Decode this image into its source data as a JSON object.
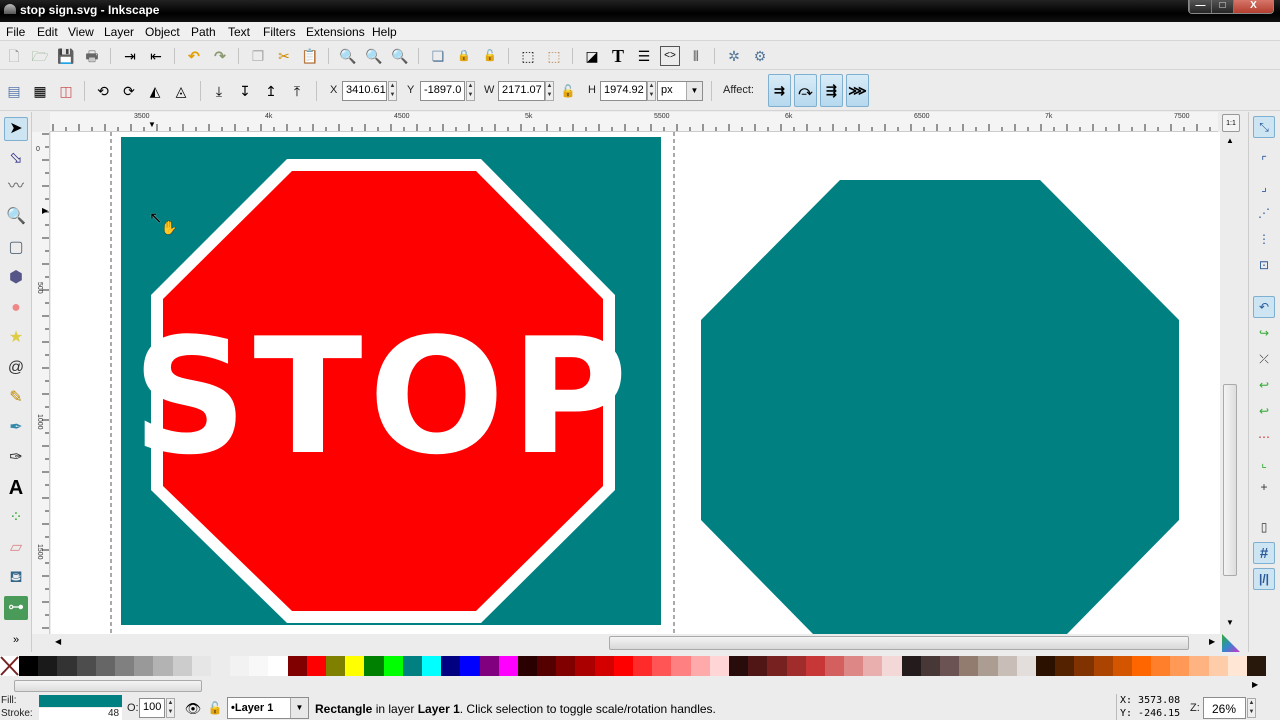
{
  "window": {
    "title": "stop sign.svg - Inkscape",
    "controls": {
      "minimize": "—",
      "maximize": "□",
      "close": "X"
    }
  },
  "menu": [
    "File",
    "Edit",
    "View",
    "Layer",
    "Object",
    "Path",
    "Text",
    "Filters",
    "Extensions",
    "Help"
  ],
  "commands_bar": [
    {
      "name": "new-document-icon",
      "glyph": "🗋"
    },
    {
      "name": "open-file-icon",
      "glyph": "🗁"
    },
    {
      "name": "save-icon",
      "glyph": "💾"
    },
    {
      "name": "print-icon",
      "glyph": "🖶"
    },
    {
      "name": "import-icon",
      "glyph": "⇥"
    },
    {
      "name": "export-icon",
      "glyph": "⇤"
    },
    {
      "name": "undo-icon",
      "glyph": "↶"
    },
    {
      "name": "redo-icon",
      "glyph": "↷"
    },
    {
      "name": "duplicate-icon",
      "glyph": "❐"
    },
    {
      "name": "cut-icon",
      "glyph": "✂"
    },
    {
      "name": "paste-icon",
      "glyph": "📋"
    },
    {
      "name": "zoom-selection-icon",
      "glyph": "🔍"
    },
    {
      "name": "zoom-drawing-icon",
      "glyph": "🔍"
    },
    {
      "name": "zoom-page-icon",
      "glyph": "🔍"
    },
    {
      "name": "duplicate-object-icon",
      "glyph": "❏"
    },
    {
      "name": "clone-icon",
      "glyph": "🔒"
    },
    {
      "name": "unlink-clone-icon",
      "glyph": "🔓"
    },
    {
      "name": "group-icon",
      "glyph": "⬚"
    },
    {
      "name": "ungroup-icon",
      "glyph": "⬚"
    },
    {
      "name": "fill-stroke-icon",
      "glyph": "◪"
    },
    {
      "name": "text-font-icon",
      "glyph": "T"
    },
    {
      "name": "layers-icon",
      "glyph": "☰"
    },
    {
      "name": "xml-editor-icon",
      "glyph": "<>"
    },
    {
      "name": "align-distribute-icon",
      "glyph": "⫴"
    },
    {
      "name": "preferences-icon",
      "glyph": "✲"
    },
    {
      "name": "document-properties-icon",
      "glyph": "⚙"
    }
  ],
  "tool_controls": {
    "select_all_icon": "▤",
    "select_all_layers_icon": "▦",
    "deselect_icon": "◫",
    "rotate_ccw_icon": "⟲",
    "rotate_cw_icon": "⟳",
    "flip_h_icon": "◭",
    "flip_v_icon": "◬",
    "lower_bottom_icon": "⤓",
    "lower_icon": "↧",
    "raise_icon": "↥",
    "raise_top_icon": "⤒",
    "x_label": "X",
    "x_value": "3410.61",
    "y_label": "Y",
    "y_value": "-1897.0",
    "w_label": "W",
    "w_value": "2171.07",
    "h_label": "H",
    "h_value": "1974.92",
    "unit": "px",
    "lock_icon": "🔓",
    "affect_label": "Affect:",
    "affect_buttons": [
      {
        "name": "scale-stroke-toggle",
        "glyph": "⇉"
      },
      {
        "name": "scale-corners-toggle",
        "glyph": "⤼"
      },
      {
        "name": "move-gradients-toggle",
        "glyph": "⇶"
      },
      {
        "name": "move-patterns-toggle",
        "glyph": "⋙"
      }
    ]
  },
  "rulers": {
    "top": [
      "3500",
      "4k",
      "4500",
      "5k",
      "5500",
      "6k",
      "6500",
      "7k",
      "7500"
    ],
    "left": [
      "0",
      "500",
      "1000",
      "1500"
    ]
  },
  "tools": [
    {
      "name": "selector-tool",
      "glyph": "➤",
      "active": true
    },
    {
      "name": "node-tool",
      "glyph": "⬂"
    },
    {
      "name": "tweak-tool",
      "glyph": "〰"
    },
    {
      "name": "zoom-tool",
      "glyph": "🔍"
    },
    {
      "name": "rectangle-tool",
      "glyph": "▢"
    },
    {
      "name": "3d-box-tool",
      "glyph": "⬢"
    },
    {
      "name": "ellipse-tool",
      "glyph": "●"
    },
    {
      "name": "star-tool",
      "glyph": "★"
    },
    {
      "name": "spiral-tool",
      "glyph": "@"
    },
    {
      "name": "pencil-tool",
      "glyph": "✎"
    },
    {
      "name": "pen-tool",
      "glyph": "✒"
    },
    {
      "name": "calligraphy-tool",
      "glyph": "✑"
    },
    {
      "name": "text-tool",
      "glyph": "A"
    },
    {
      "name": "spray-tool",
      "glyph": "⁘"
    },
    {
      "name": "eraser-tool",
      "glyph": "▱"
    },
    {
      "name": "paint-bucket-tool",
      "glyph": "⛾"
    },
    {
      "name": "connector-tool",
      "glyph": "⊶"
    }
  ],
  "toolbox_overflow": "»",
  "canvas": {
    "sign_text": "STOP",
    "colors": {
      "teal": "#008080",
      "red": "#ff0000",
      "white": "#ffffff"
    }
  },
  "zoom_1to1_label": "1:1",
  "snap_controls": [
    {
      "name": "snap-toggle",
      "glyph": "⤡",
      "on": true
    },
    {
      "name": "snap-bbox",
      "glyph": "⌜"
    },
    {
      "name": "snap-bbox-edges",
      "glyph": "⌟"
    },
    {
      "name": "snap-bbox-corners",
      "glyph": "⋰"
    },
    {
      "name": "snap-bbox-midpoints",
      "glyph": "⋮"
    },
    {
      "name": "snap-bbox-centers",
      "glyph": "⊡"
    },
    {
      "name": "snap-nodes",
      "glyph": "↶",
      "on": true
    },
    {
      "name": "snap-paths",
      "glyph": "↪"
    },
    {
      "name": "snap-path-intersections",
      "glyph": "⤫"
    },
    {
      "name": "snap-cusp-nodes",
      "glyph": "↩"
    },
    {
      "name": "snap-smooth-nodes",
      "glyph": "↩"
    },
    {
      "name": "snap-line-midpoints",
      "glyph": "⋯"
    },
    {
      "name": "snap-object-midpoints",
      "glyph": "⌞"
    },
    {
      "name": "snap-rotation-center",
      "glyph": "+"
    },
    {
      "name": "snap-page-border",
      "glyph": "▯"
    },
    {
      "name": "snap-grids",
      "glyph": "#",
      "on": true
    },
    {
      "name": "snap-guides",
      "glyph": "|/|",
      "on": true
    }
  ],
  "palette": [
    "none",
    "#000000",
    "#1a1a1a",
    "#333333",
    "#4d4d4d",
    "#666666",
    "#808080",
    "#999999",
    "#b3b3b3",
    "#cccccc",
    "#e6e6e6",
    "#ececec",
    "#f2f2f2",
    "#f8f8f8",
    "#ffffff",
    "#800000",
    "#ff0000",
    "#808000",
    "#ffff00",
    "#008000",
    "#00ff00",
    "#008080",
    "#00ffff",
    "#000080",
    "#0000ff",
    "#800080",
    "#ff00ff",
    "#2b0000",
    "#550000",
    "#800000",
    "#aa0000",
    "#d40000",
    "#ff0000",
    "#ff2a2a",
    "#ff5555",
    "#ff8080",
    "#ffaaaa",
    "#ffd5d5",
    "#280b0b",
    "#501616",
    "#782121",
    "#a02c2c",
    "#c83737",
    "#d35f5f",
    "#de8787",
    "#e9afaf",
    "#f4d7d7",
    "#241c1c",
    "#483737",
    "#6c5353",
    "#917c6f",
    "#ac9d93",
    "#c8beb7",
    "#e3dedb",
    "#2b1100",
    "#552200",
    "#803300",
    "#aa4400",
    "#d45500",
    "#ff6600",
    "#ff7f2a",
    "#ff9955",
    "#ffb380",
    "#ffccaa",
    "#ffe6d5",
    "#28170b"
  ],
  "status": {
    "fill_label": "Fill:",
    "stroke_label": "Stroke:",
    "fill_color": "#008080",
    "stroke_width": "48",
    "opacity_label": "O:",
    "opacity_value": "100",
    "visibility_icon": "👁",
    "lock_icon": "🔓",
    "layer": "•Layer 1",
    "message_bold1": "Rectangle",
    "message_mid": " in layer ",
    "message_bold2": "Layer 1",
    "message_end": ". Click selection to toggle scale/rotation handles.",
    "cursor_x": "X: 3573.08",
    "cursor_y": "Y: -246.15",
    "zoom_label": "Z:",
    "zoom_value": "26%"
  }
}
